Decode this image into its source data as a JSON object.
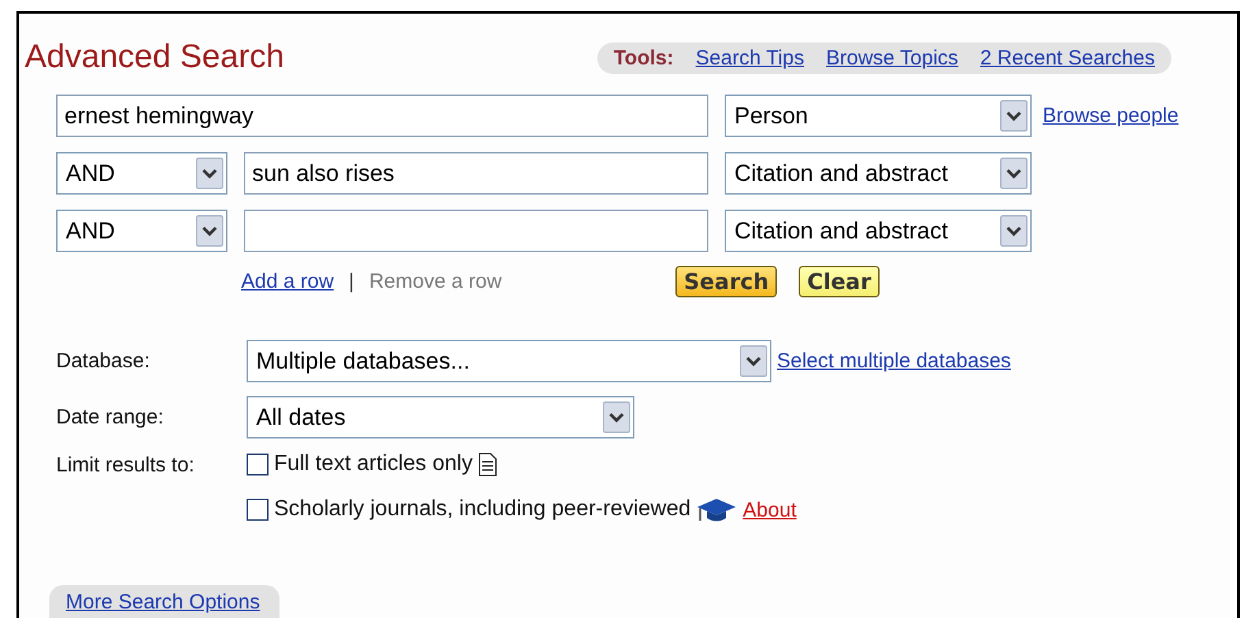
{
  "title": "Advanced Search",
  "tools": {
    "label": "Tools:",
    "links": [
      "Search Tips",
      "Browse Topics",
      "2 Recent Searches"
    ]
  },
  "search_rows": [
    {
      "term": "ernest hemingway",
      "field": "Person",
      "link": "Browse people"
    },
    {
      "operator": "AND",
      "term": "sun also rises",
      "field": "Citation and abstract"
    },
    {
      "operator": "AND",
      "field": "Citation and abstract"
    }
  ],
  "row_actions": {
    "add": "Add a row",
    "separator": "|",
    "remove": "Remove a row",
    "remove_disabled": true
  },
  "buttons": [
    {
      "label": "Search",
      "kind": "primary"
    },
    {
      "label": "Clear",
      "kind": "secondary"
    }
  ],
  "database": {
    "label": "Database:",
    "value": "Multiple databases...",
    "link": "Select multiple databases"
  },
  "date_range": {
    "label": "Date range:",
    "value": "All dates"
  },
  "limits": {
    "label": "Limit results to:",
    "options": [
      {
        "label": "Full text articles only",
        "checked": false,
        "kind": "document"
      },
      {
        "label": "Scholarly journals, including peer-reviewed",
        "checked": false,
        "kind": "mortarboard",
        "link": "About"
      }
    ]
  },
  "more_options": "More Search Options"
}
